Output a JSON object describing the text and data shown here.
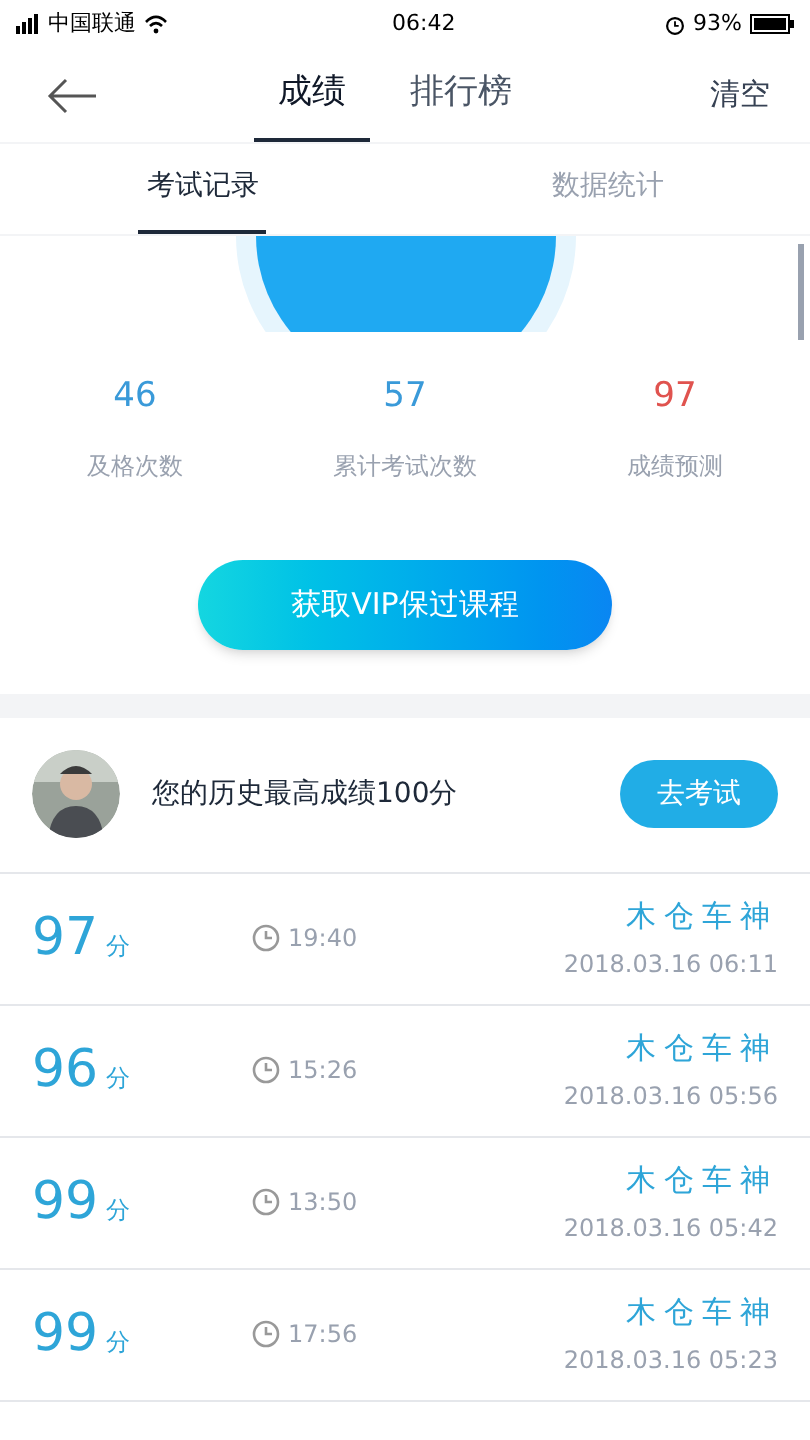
{
  "status_bar": {
    "carrier": "中国联通",
    "time": "06:42",
    "battery": "93%"
  },
  "header": {
    "tabs": [
      {
        "label": "成绩",
        "selected": true
      },
      {
        "label": "排行榜",
        "selected": false
      }
    ],
    "action": "清空"
  },
  "sub_tabs": [
    {
      "label": "考试记录",
      "selected": true
    },
    {
      "label": "数据统计",
      "selected": false
    }
  ],
  "stats": [
    {
      "value": "46",
      "label": "及格次数",
      "color": "#3a9ad9"
    },
    {
      "value": "57",
      "label": "累计考试次数",
      "color": "#3a9ad9"
    },
    {
      "value": "97",
      "label": "成绩预测",
      "color": "#e0534f"
    }
  ],
  "vip_button": "获取VIP保过课程",
  "best": {
    "text": "您的历史最高成绩100分",
    "button": "去考试"
  },
  "records": [
    {
      "score": "97",
      "unit": "分",
      "duration": "19:40",
      "title": "木仓车神",
      "date": "2018.03.16 06:11"
    },
    {
      "score": "96",
      "unit": "分",
      "duration": "15:26",
      "title": "木仓车神",
      "date": "2018.03.16 05:56"
    },
    {
      "score": "99",
      "unit": "分",
      "duration": "13:50",
      "title": "木仓车神",
      "date": "2018.03.16 05:42"
    },
    {
      "score": "99",
      "unit": "分",
      "duration": "17:56",
      "title": "木仓车神",
      "date": "2018.03.16 05:23"
    }
  ]
}
